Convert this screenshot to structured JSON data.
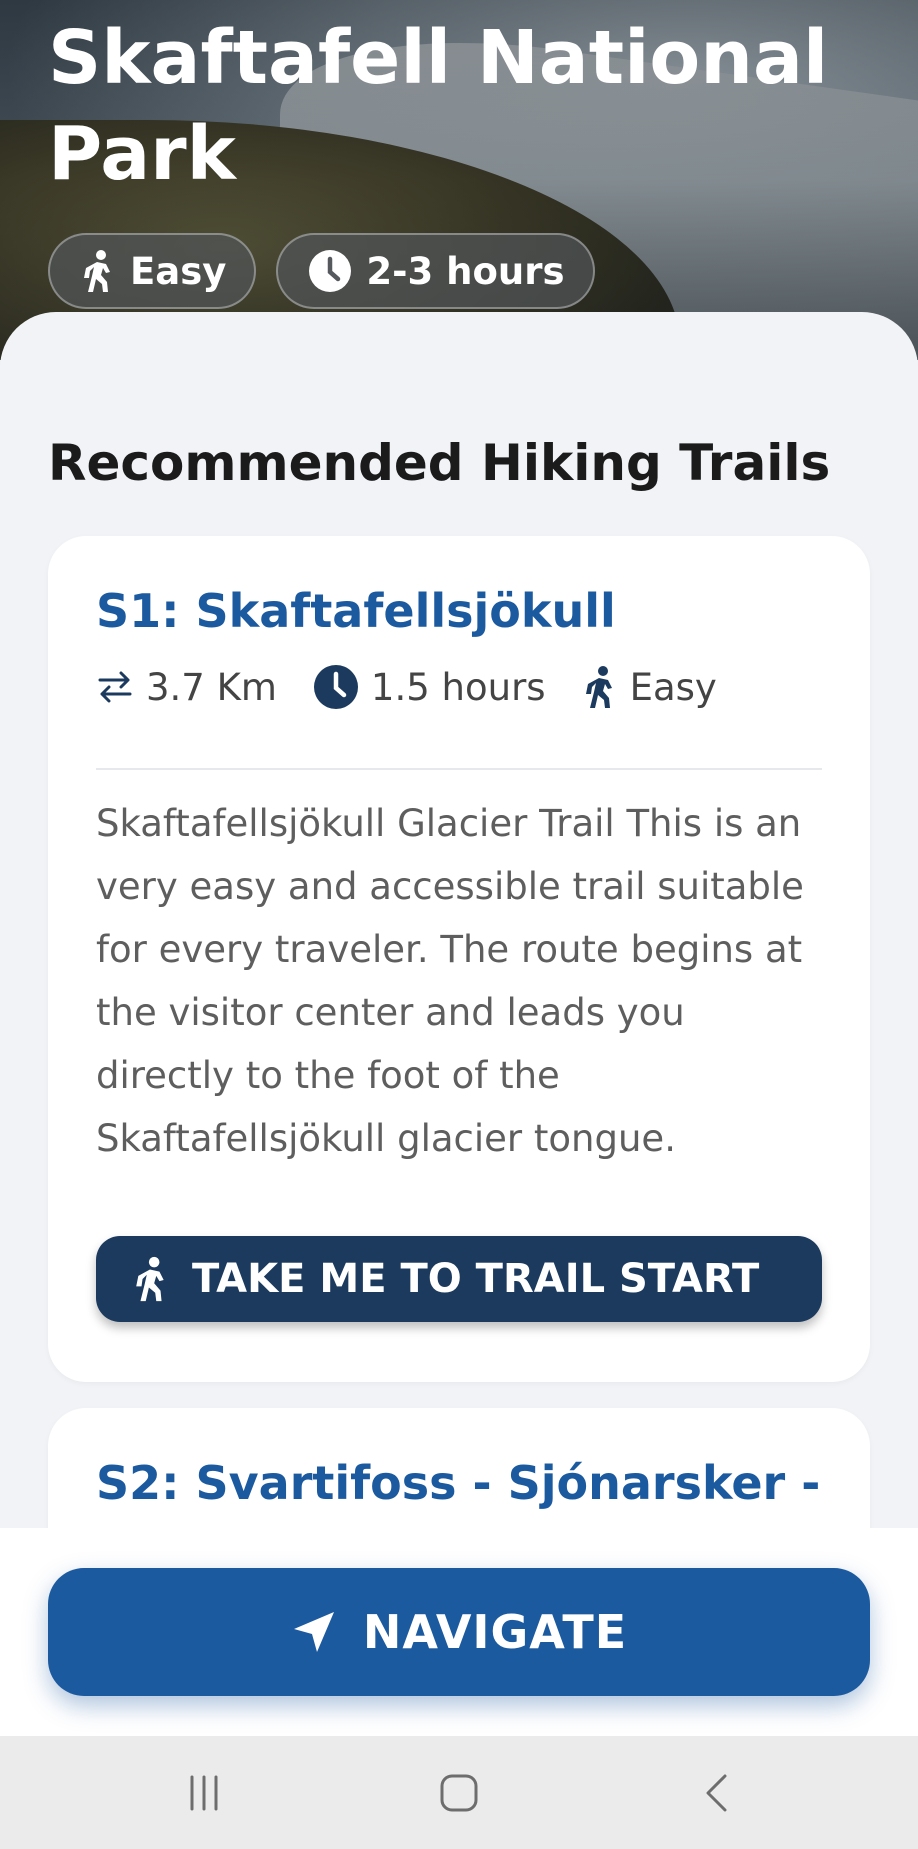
{
  "hero": {
    "title": "Skaftafell National Park",
    "chips": [
      {
        "icon": "hiker-icon",
        "label": "Easy"
      },
      {
        "icon": "clock-icon",
        "label": "2-3 hours"
      }
    ]
  },
  "section": {
    "title": "Recommended Hiking Trails"
  },
  "trails": [
    {
      "title": "S1: Skaftafellsjökull",
      "distance": "3.7 Km",
      "duration": "1.5 hours",
      "difficulty": "Easy",
      "description": "Skaftafellsjökull Glacier Trail This is an very easy and accessible trail suitable for every traveler. The route begins at the visitor center and leads you directly to the foot of the Skaftafellsjökull glacier tongue.",
      "button_label": "TAKE ME TO TRAIL START"
    },
    {
      "title": "S2: Svartifoss - Sjónarsker -"
    }
  ],
  "bottom": {
    "navigate_label": "NAVIGATE"
  },
  "system_nav": [
    "recents-icon",
    "home-icon",
    "back-icon"
  ],
  "colors": {
    "accent": "#1c5aa0",
    "dark_button": "#1b3a5e",
    "title_blue": "#1c5aa0"
  }
}
